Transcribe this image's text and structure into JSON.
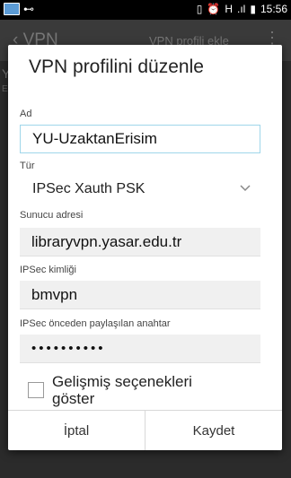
{
  "status_bar": {
    "time": "15:56",
    "network": "H",
    "signal": ".ıl"
  },
  "app_bar": {
    "title": "VPN",
    "action": "VPN profili ekle",
    "more": "⋮"
  },
  "behind": {
    "line1": "Y",
    "line2": "E"
  },
  "dialog": {
    "title": "VPN profilini düzenle",
    "name_label": "Ad",
    "name_value": "YU-UzaktanErisim",
    "type_label": "Tür",
    "type_value": "IPSec Xauth PSK",
    "server_label": "Sunucu adresi",
    "server_value": "libraryvpn.yasar.edu.tr",
    "ipsec_id_label": "IPSec kimliği",
    "ipsec_id_value": "bmvpn",
    "psk_label": "IPSec önceden paylaşılan anahtar",
    "psk_value": "••••••••••",
    "advanced_label": "Gelişmiş seçenekleri göster",
    "cancel_label": "İptal",
    "save_label": "Kaydet"
  },
  "colors": {
    "focus_border": "#9fd6ea",
    "dialog_bg": "#ffffff",
    "dim_bg": "#2b2b2b"
  }
}
